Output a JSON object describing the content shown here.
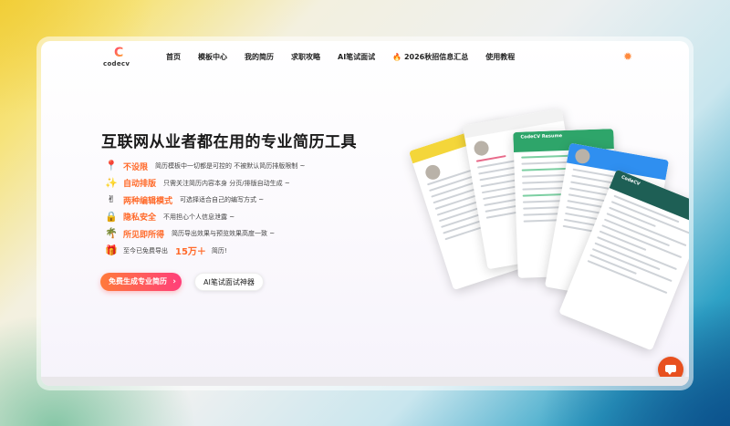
{
  "nav": {
    "logo_mark": "C",
    "logo_text": "codecv",
    "items": [
      {
        "label": "首页"
      },
      {
        "label": "模板中心"
      },
      {
        "label": "我的简历"
      },
      {
        "label": "求职攻略"
      },
      {
        "label": "AI笔试面试"
      },
      {
        "label": "2026秋招信息汇总",
        "icon": "fire-icon"
      },
      {
        "label": "使用教程"
      }
    ],
    "theme_icon": "sun-icon"
  },
  "hero": {
    "title": "互联网从业者都在用的专业简历工具",
    "features": [
      {
        "icon": "pin-icon",
        "name": "不设限",
        "desc": "简历模板中一切都是可控的 不被默认简历排版限制 ~"
      },
      {
        "icon": "sparkles-icon",
        "name": "自动排版",
        "desc": "只需关注简历内容本身 分页/排版自动生成 ~"
      },
      {
        "icon": "peace-hand-icon",
        "name": "两种编辑模式",
        "desc": "可选择适合自己的编写方式 ~"
      },
      {
        "icon": "lock-icon",
        "name": "隐私安全",
        "desc": "不用担心个人信息泄露 ~"
      },
      {
        "icon": "palm-tree-icon",
        "name": "所见即所得",
        "desc": "简历导出效果与预览效果高度一致 ~"
      }
    ],
    "export": {
      "icon": "gift-icon",
      "prefix": "至今已免费导出",
      "count": "15万＋",
      "suffix": "简历!"
    },
    "primary_button": "免费生成专业简历",
    "secondary_button": "AI笔试面试神器"
  },
  "cards": {
    "card3_title": "CodeCV Resume",
    "card5_title": "CodeCV"
  },
  "colors": {
    "accent_orange": "#ff6a2a",
    "button_gradient_start": "#ff7a3a",
    "button_gradient_end": "#ff3f7a",
    "card_yellow": "#f4d63a",
    "card_green": "#2ea56a",
    "card_blue": "#2f8ff0",
    "card_teal": "#1e5f55",
    "chat_button": "#e8501f"
  },
  "chat_icon": "chat-bubble-icon"
}
